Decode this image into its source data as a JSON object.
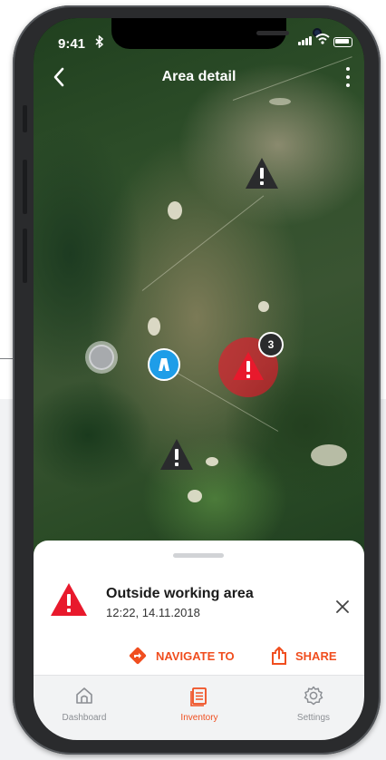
{
  "status_bar": {
    "time": "9:41"
  },
  "header": {
    "title": "Area detail"
  },
  "map": {
    "cluster_count": "3"
  },
  "alert": {
    "title": "Outside working area",
    "timestamp": "12:22, 14.11.2018",
    "navigate_label": "NAVIGATE TO",
    "share_label": "SHARE"
  },
  "tabs": [
    {
      "label": "Dashboard",
      "icon": "home-icon",
      "active": false
    },
    {
      "label": "Inventory",
      "icon": "inventory-icon",
      "active": true
    },
    {
      "label": "Settings",
      "icon": "gear-icon",
      "active": false
    }
  ],
  "colors": {
    "accent": "#f04e1f",
    "alert_red": "#e8192c",
    "location_blue": "#1e9de8"
  }
}
